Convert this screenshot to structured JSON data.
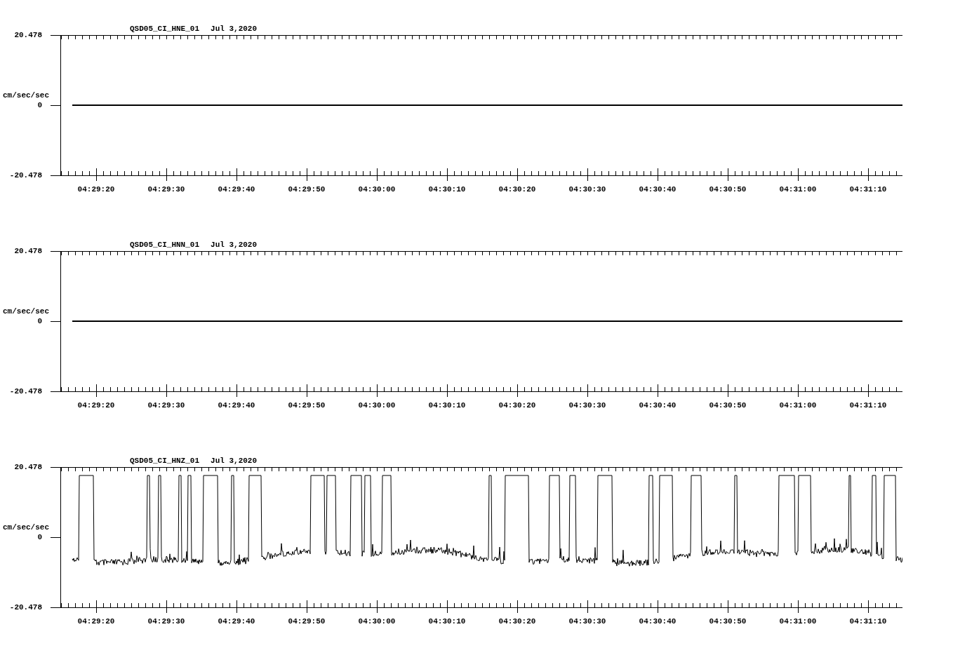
{
  "plots": [
    {
      "station": "QSD05_CI_HNE_01",
      "date": "Jul 3,2020",
      "ylabel": "cm/sec/sec",
      "yticks": [
        "20.478",
        "0",
        "-20.478"
      ],
      "xticks": [
        "04:29:20",
        "04:29:30",
        "04:29:40",
        "04:29:50",
        "04:30:00",
        "04:30:10",
        "04:30:20",
        "04:30:30",
        "04:30:40",
        "04:30:50",
        "04:31:00",
        "04:31:10"
      ],
      "kind": "flat"
    },
    {
      "station": "QSD05_CI_HNN_01",
      "date": "Jul 3,2020",
      "ylabel": "cm/sec/sec",
      "yticks": [
        "20.478",
        "0",
        "-20.478"
      ],
      "xticks": [
        "04:29:20",
        "04:29:30",
        "04:29:40",
        "04:29:50",
        "04:30:00",
        "04:30:10",
        "04:30:20",
        "04:30:30",
        "04:30:40",
        "04:30:50",
        "04:31:00",
        "04:31:10"
      ],
      "kind": "flat"
    },
    {
      "station": "QSD05_CI_HNZ_01",
      "date": "Jul 3,2020",
      "ylabel": "cm/sec/sec",
      "yticks": [
        "20.478",
        "0",
        "-20.478"
      ],
      "xticks": [
        "04:29:20",
        "04:29:30",
        "04:29:40",
        "04:29:50",
        "04:30:00",
        "04:30:10",
        "04:30:20",
        "04:30:30",
        "04:30:40",
        "04:30:50",
        "04:31:00",
        "04:31:10"
      ],
      "kind": "noisy"
    }
  ]
}
